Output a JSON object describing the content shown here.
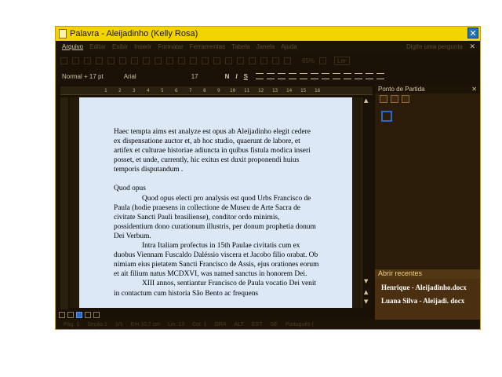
{
  "window": {
    "title": "Palavra - Aleijadinho (Kelly Rosa)"
  },
  "menu": {
    "items": [
      "Arquivo",
      "Editar",
      "Exibir",
      "Inserir",
      "Formatar",
      "Ferramentas",
      "Tabela",
      "Janela",
      "Ajuda"
    ],
    "ask": "Digite uma pergunta"
  },
  "toolbar": {
    "zoom": "65%",
    "read_label": "Ler"
  },
  "format": {
    "style": "Normal + 17 pt",
    "font": "Arial",
    "size": "17",
    "bold": "N",
    "italic": "I",
    "underline": "S"
  },
  "ruler": {
    "ticks": [
      "1",
      "2",
      "3",
      "4",
      "5",
      "6",
      "7",
      "8",
      "9",
      "10",
      "11",
      "12",
      "13",
      "14",
      "15",
      "16"
    ]
  },
  "document": {
    "p1": "Haec tempta aims est analyze est opus ab Aleijadinho elegit cedere ex dispensatione auctor et, ab hoc studio, quaerunt de labore, et artifex et culturae historiae adiuncta in quibus fistula modica inseri posset, et unde, currently, hic exitus est duxit proponendi huius temporis disputandum .",
    "heading": "Quod opus",
    "p2": "Quod opus electi pro analysis est quod Urbs Francisco de Paula (hodie praesens in collectione de Museu de Arte Sacra de civitate Sancti Pauli brasiliense), conditor ordo minimis, possidentium dono curationum illustris, per donum prophetia donum Dei Verbum.",
    "p3": "Intra Italiam profectus in 15th Paulae civitatis cum ex duobus Viennam Fuscaldo Daléssio viscera et Jacobo filio orabat. Ob nimiam eius pietatem Sancti Francisco de Assis, ejus orationes eorum et ait filium natus MCDXVI, was named sanctus in honorem Dei.",
    "p4": "XIII annos, sentiantur Francisco de Paula vocatio Dei venit in contactum cum historia São Bento ac frequens"
  },
  "pane": {
    "title": "Ponto de Partida",
    "recent_title": "Abrir recentes",
    "recent": [
      "Henrique - Aleijadinho.docx",
      "Luana Silva - Aleijadi. docx"
    ]
  },
  "status": {
    "page": "Pág. 1",
    "section": "Seção 1",
    "pages": "1/1",
    "at": "Em 10,7 cm",
    "line": "Lin. 13",
    "col": "Col. 1",
    "modes": [
      "GRA",
      "ALT",
      "EST",
      "SE"
    ],
    "lang": "Português ("
  },
  "colors": {
    "titlebar": "#f2d500",
    "chrome": "#1a1207",
    "page": "#dce8f6",
    "recent_panel": "#4a3010"
  }
}
